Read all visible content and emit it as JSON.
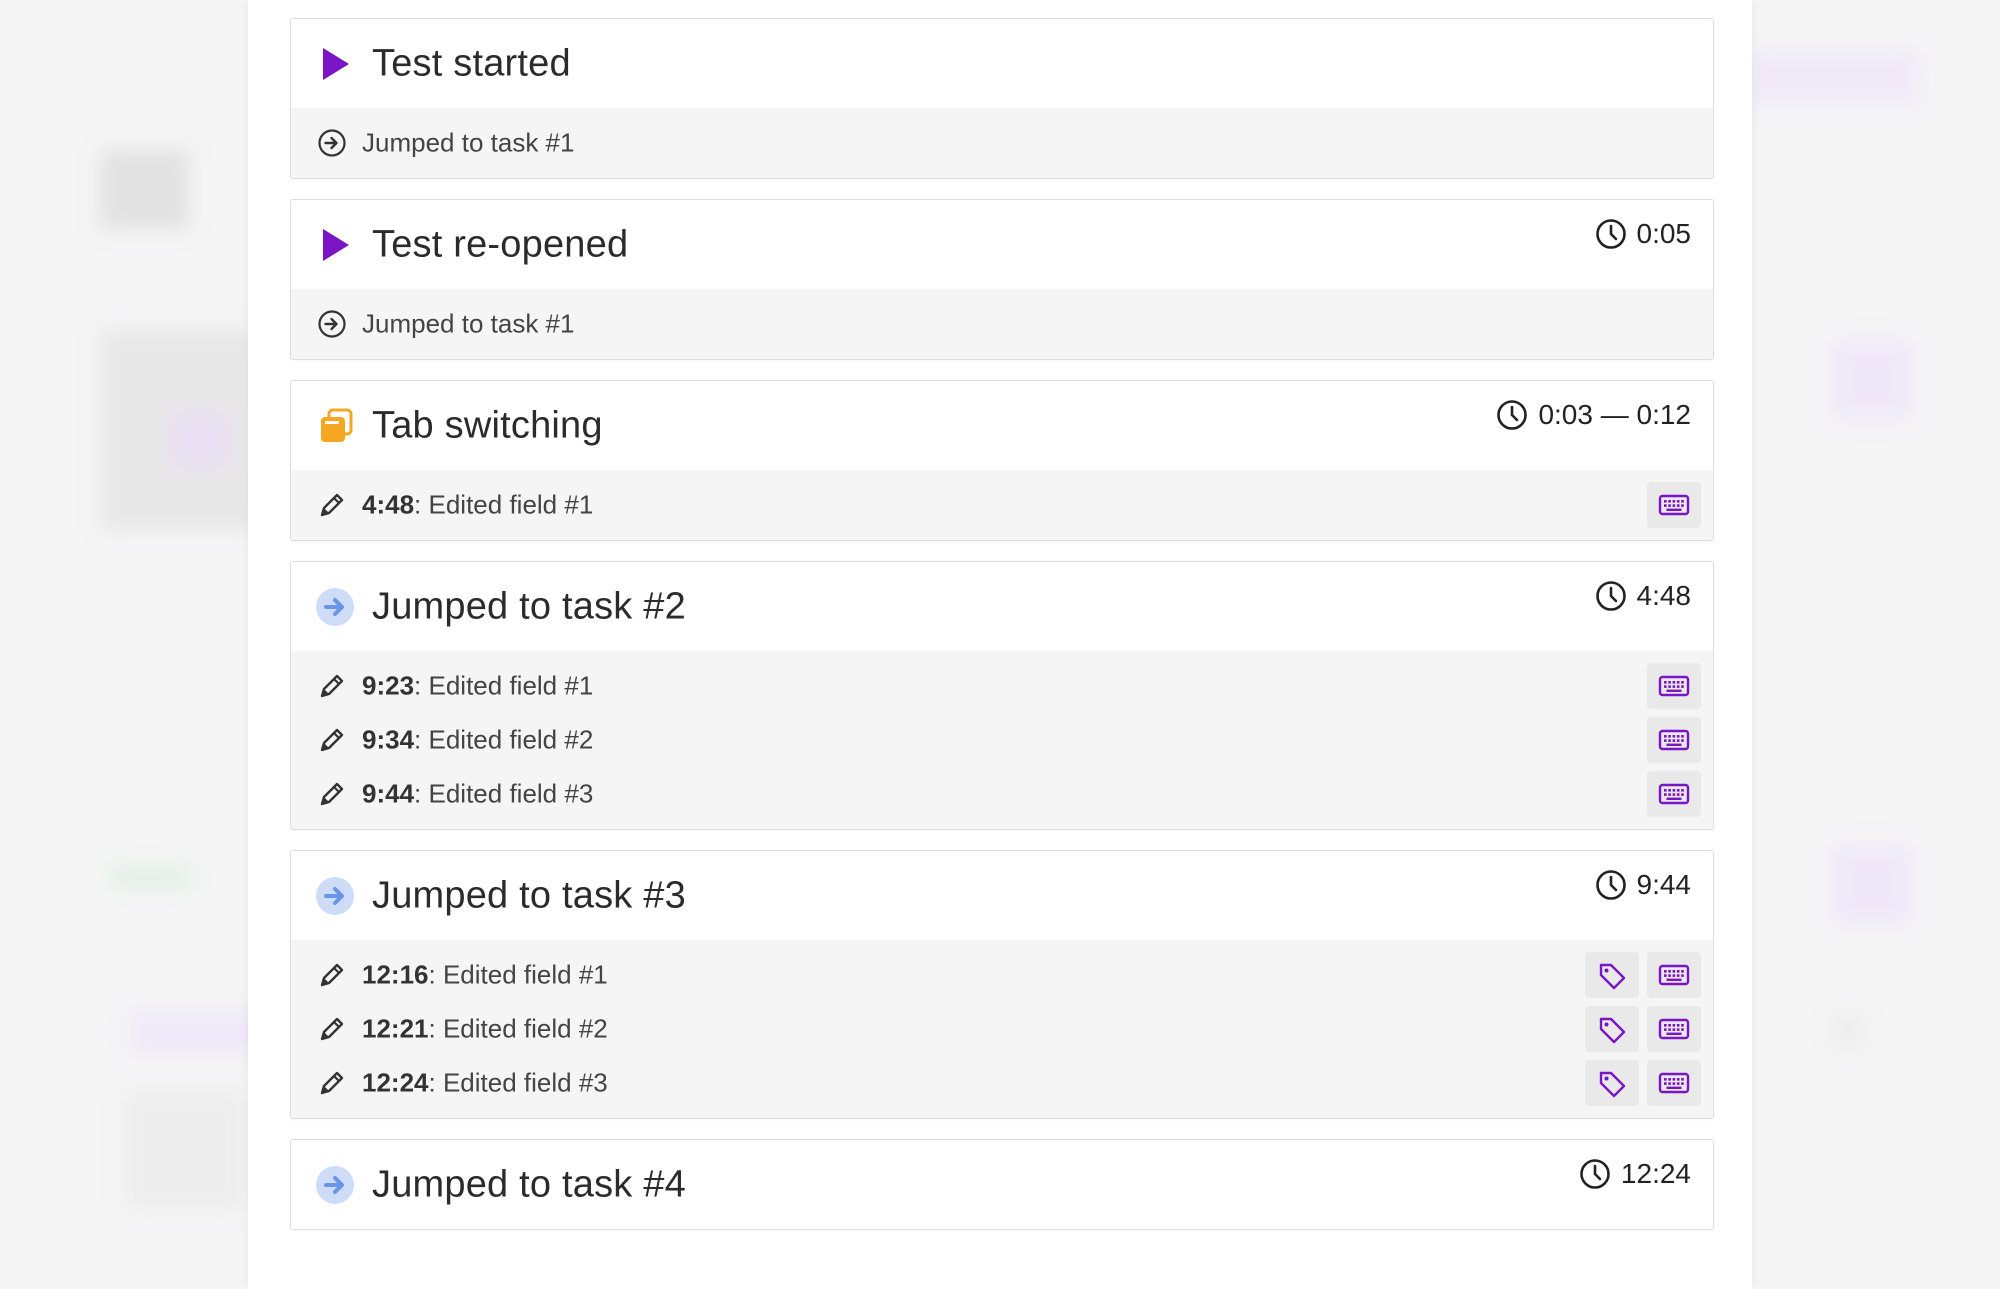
{
  "colors": {
    "accent_purple": "#7a14c4",
    "tab_orange": "#f5a623",
    "jump_blue": "#6b95e8",
    "jump_blue_bg": "#cfdcf7"
  },
  "events": [
    {
      "icon": "play-icon",
      "title": "Test started",
      "time": "",
      "rows": [
        {
          "icon": "arrow-circle-icon",
          "time": "",
          "text": "Jumped to task #1",
          "actions": []
        }
      ]
    },
    {
      "icon": "play-icon",
      "title": "Test re-opened",
      "time": "0:05",
      "rows": [
        {
          "icon": "arrow-circle-icon",
          "time": "",
          "text": "Jumped to task #1",
          "actions": []
        }
      ]
    },
    {
      "icon": "tab-switch-icon",
      "title": "Tab switching",
      "time": "0:03 — 0:12",
      "rows": [
        {
          "icon": "pencil-icon",
          "time": "4:48",
          "text": ": Edited field #1",
          "actions": [
            "keyboard-icon"
          ]
        }
      ]
    },
    {
      "icon": "jump-icon",
      "title": "Jumped to task #2",
      "time": "4:48",
      "rows": [
        {
          "icon": "pencil-icon",
          "time": "9:23",
          "text": ": Edited field #1",
          "actions": [
            "keyboard-icon"
          ]
        },
        {
          "icon": "pencil-icon",
          "time": "9:34",
          "text": ": Edited field #2",
          "actions": [
            "keyboard-icon"
          ]
        },
        {
          "icon": "pencil-icon",
          "time": "9:44",
          "text": ": Edited field #3",
          "actions": [
            "keyboard-icon"
          ]
        }
      ]
    },
    {
      "icon": "jump-icon",
      "title": "Jumped to task #3",
      "time": "9:44",
      "rows": [
        {
          "icon": "pencil-icon",
          "time": "12:16",
          "text": ": Edited field #1",
          "actions": [
            "tag-icon",
            "keyboard-icon"
          ]
        },
        {
          "icon": "pencil-icon",
          "time": "12:21",
          "text": ": Edited field #2",
          "actions": [
            "tag-icon",
            "keyboard-icon"
          ]
        },
        {
          "icon": "pencil-icon",
          "time": "12:24",
          "text": ": Edited field #3",
          "actions": [
            "tag-icon",
            "keyboard-icon"
          ]
        }
      ]
    },
    {
      "icon": "jump-icon",
      "title": "Jumped to task #4",
      "time": "12:24",
      "rows": []
    }
  ]
}
